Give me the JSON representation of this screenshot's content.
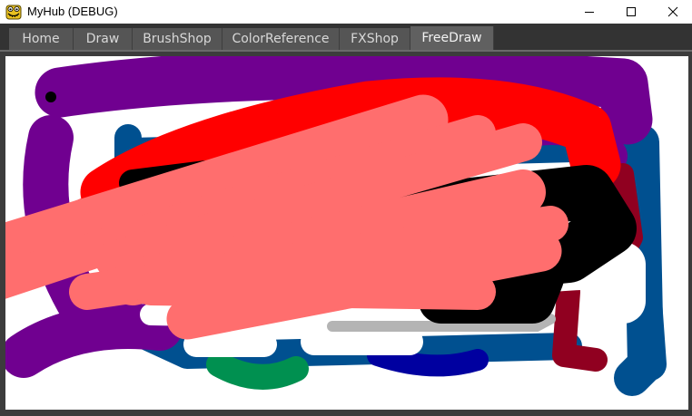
{
  "window": {
    "title": "MyHub (DEBUG)",
    "icon": "frog-face-icon",
    "controls": [
      "minimize-icon",
      "maximize-icon",
      "close-icon"
    ]
  },
  "tabs": [
    {
      "label": "Home",
      "active": false
    },
    {
      "label": "Draw",
      "active": false
    },
    {
      "label": "BrushShop",
      "active": false
    },
    {
      "label": "ColorReference",
      "active": false
    },
    {
      "label": "FXShop",
      "active": false
    },
    {
      "label": "FreeDraw",
      "active": true
    }
  ],
  "canvas": {
    "background": "#ffffff",
    "stroke_colors": [
      "#700090",
      "#ff0000",
      "#000000",
      "#ff6e6e",
      "#005090",
      "#900020",
      "#009050",
      "#0000a0",
      "#b4b4b4",
      "#ffffff"
    ]
  }
}
